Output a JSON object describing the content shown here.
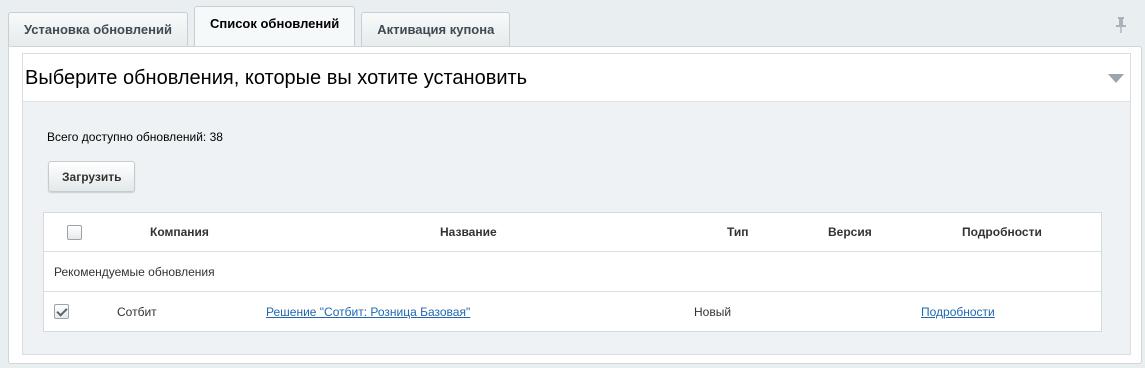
{
  "tabs": [
    {
      "label": "Установка обновлений"
    },
    {
      "label": "Список обновлений"
    },
    {
      "label": "Активация купона"
    }
  ],
  "active_tab": 1,
  "section": {
    "title": "Выберите обновления, которые вы хотите установить"
  },
  "summary": {
    "total_text": "Всего доступно обновлений: 38"
  },
  "actions": {
    "load_label": "Загрузить"
  },
  "table": {
    "columns": [
      "Компания",
      "Название",
      "Тип",
      "Версия",
      "Подробности"
    ],
    "group_label": "Рекомендуемые обновления",
    "rows": [
      {
        "checked": true,
        "company": "Сотбит",
        "name": "Решение \"Сотбит: Розница Базовая\"",
        "type": "Новый",
        "version": "",
        "details": "Подробности"
      }
    ]
  },
  "icons": {
    "pin": "pin-icon",
    "collapse": "chevron-down-icon",
    "checkbox": "checkbox-icon"
  },
  "colors": {
    "background": "#e9eef0",
    "link": "#2067b0",
    "panel": "#ffffff"
  }
}
